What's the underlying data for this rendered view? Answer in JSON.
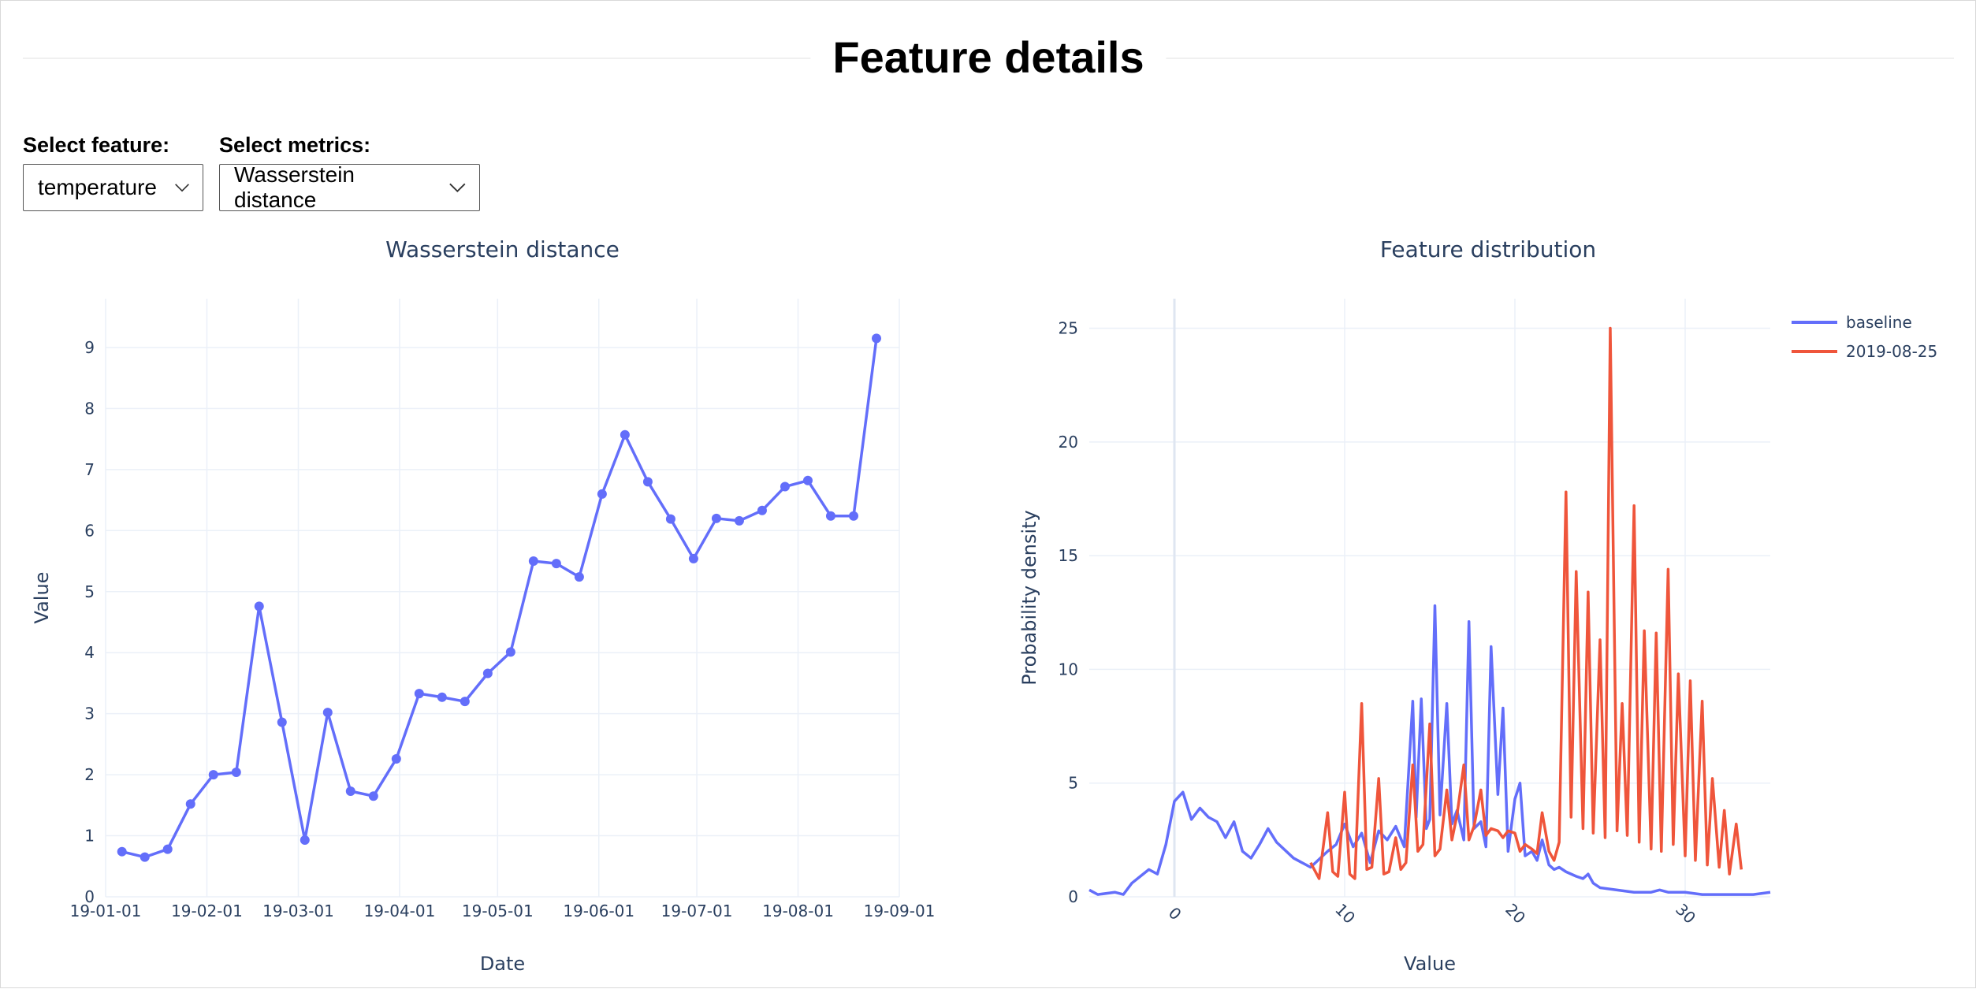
{
  "page": {
    "title": "Feature details"
  },
  "controls": {
    "feature_label": "Select feature:",
    "feature_value": "temperature",
    "metric_label": "Select metrics:",
    "metric_value": "Wasserstein distance"
  },
  "colors": {
    "primary": "#636efa",
    "secondary": "#ef553b",
    "text": "#2a3f5f",
    "grid": "#ebf0f8"
  },
  "chart_data": [
    {
      "type": "line",
      "title": "Wasserstein distance",
      "xlabel": "Date",
      "ylabel": "Value",
      "x_ticks": [
        "19-01-01",
        "19-02-01",
        "19-03-01",
        "19-04-01",
        "19-05-01",
        "19-06-01",
        "19-07-01",
        "19-08-01",
        "19-09-01"
      ],
      "y_ticks": [
        0,
        1,
        2,
        3,
        4,
        5,
        6,
        7,
        8,
        9
      ],
      "xlim": [
        "2019-01-01",
        "2019-09-01"
      ],
      "ylim": [
        0,
        9.8
      ],
      "grid": true,
      "series": [
        {
          "x": [
            "2019-01-06",
            "2019-01-13",
            "2019-01-20",
            "2019-01-27",
            "2019-02-03",
            "2019-02-10",
            "2019-02-17",
            "2019-02-24",
            "2019-03-03",
            "2019-03-10",
            "2019-03-17",
            "2019-03-24",
            "2019-03-31",
            "2019-04-07",
            "2019-04-14",
            "2019-04-21",
            "2019-04-28",
            "2019-05-05",
            "2019-05-12",
            "2019-05-19",
            "2019-05-26",
            "2019-06-02",
            "2019-06-09",
            "2019-06-16",
            "2019-06-23",
            "2019-06-30",
            "2019-07-07",
            "2019-07-14",
            "2019-07-21",
            "2019-07-28",
            "2019-08-04",
            "2019-08-11",
            "2019-08-18",
            "2019-08-25"
          ],
          "values": [
            0.74,
            0.65,
            0.78,
            1.52,
            2.0,
            2.04,
            4.76,
            2.86,
            0.93,
            3.02,
            1.73,
            1.65,
            2.26,
            3.33,
            3.27,
            3.2,
            3.66,
            4.01,
            5.5,
            5.46,
            5.24,
            6.6,
            7.57,
            6.8,
            6.19,
            5.54,
            6.2,
            6.16,
            6.33,
            6.72,
            6.82,
            6.24,
            6.24,
            9.15
          ]
        }
      ]
    },
    {
      "type": "line",
      "title": "Feature distribution",
      "xlabel": "Value",
      "ylabel": "Probability density",
      "x_ticks": [
        0,
        10,
        20,
        30
      ],
      "y_ticks": [
        0,
        5,
        10,
        15,
        20,
        25
      ],
      "xlim": [
        -5,
        35
      ],
      "ylim": [
        0,
        26.3
      ],
      "grid": true,
      "legend": "top-right",
      "series": [
        {
          "name": "baseline",
          "x": [
            -5,
            -4.5,
            -3.5,
            -3,
            -2.5,
            -2,
            -1.5,
            -1,
            -0.5,
            0,
            0.5,
            1,
            1.5,
            2,
            2.5,
            3,
            3.5,
            4,
            4.5,
            5,
            5.5,
            6,
            7,
            8,
            9,
            9.5,
            10,
            10.5,
            11,
            11.5,
            12,
            12.5,
            13,
            13.5,
            14,
            14.2,
            14.5,
            14.8,
            15,
            15.3,
            15.6,
            16,
            16.3,
            16.6,
            17,
            17.3,
            17.6,
            18,
            18.3,
            18.6,
            19,
            19.3,
            19.6,
            20,
            20.3,
            20.6,
            21,
            21.3,
            21.6,
            22,
            22.3,
            22.6,
            23,
            23.3,
            23.6,
            24,
            24.3,
            24.6,
            25,
            26,
            27,
            28,
            28.5,
            29,
            30,
            31,
            32,
            33,
            34,
            35
          ],
          "values": [
            0.3,
            0.1,
            0.2,
            0.1,
            0.6,
            0.9,
            1.2,
            1.0,
            2.3,
            4.2,
            4.6,
            3.4,
            3.9,
            3.5,
            3.3,
            2.6,
            3.3,
            2.0,
            1.7,
            2.3,
            3.0,
            2.4,
            1.7,
            1.3,
            2.0,
            2.3,
            3.2,
            2.2,
            2.8,
            1.5,
            2.9,
            2.5,
            3.1,
            2.2,
            8.6,
            3.5,
            8.7,
            3.0,
            3.4,
            12.8,
            3.6,
            8.5,
            3.2,
            3.8,
            2.5,
            12.1,
            3.0,
            3.3,
            2.2,
            11.0,
            4.5,
            8.3,
            2.0,
            4.3,
            5.0,
            1.8,
            2.0,
            1.6,
            2.5,
            1.4,
            1.2,
            1.3,
            1.1,
            1.0,
            0.9,
            0.8,
            1.0,
            0.6,
            0.4,
            0.3,
            0.2,
            0.2,
            0.3,
            0.2,
            0.2,
            0.1,
            0.1,
            0.1,
            0.1,
            0.2
          ]
        },
        {
          "name": "2019-08-25",
          "x": [
            8,
            8.5,
            9,
            9.3,
            9.6,
            10,
            10.3,
            10.6,
            11,
            11.3,
            11.6,
            12,
            12.3,
            12.6,
            13,
            13.3,
            13.6,
            14,
            14.3,
            14.6,
            15,
            15.3,
            15.6,
            16,
            16.3,
            16.6,
            17,
            17.3,
            17.6,
            18,
            18.3,
            18.6,
            19,
            19.3,
            19.6,
            20,
            20.3,
            20.6,
            21,
            21.3,
            21.6,
            22,
            22.3,
            22.6,
            23,
            23.3,
            23.6,
            24,
            24.3,
            24.6,
            25,
            25.3,
            25.6,
            26,
            26.3,
            26.6,
            27,
            27.3,
            27.6,
            28,
            28.3,
            28.6,
            29,
            29.3,
            29.6,
            30,
            30.3,
            30.6,
            31,
            31.3,
            31.6,
            32,
            32.3,
            32.6,
            33,
            33.3
          ],
          "values": [
            1.5,
            0.8,
            3.7,
            1.1,
            0.9,
            4.6,
            1.0,
            0.8,
            8.5,
            1.2,
            1.3,
            5.2,
            1.0,
            1.1,
            2.6,
            1.2,
            1.5,
            5.8,
            2.0,
            2.3,
            7.6,
            1.8,
            2.1,
            4.7,
            2.5,
            3.6,
            5.8,
            2.5,
            3.1,
            4.7,
            2.7,
            3.0,
            2.9,
            2.6,
            2.9,
            2.8,
            2.0,
            2.3,
            2.1,
            1.9,
            3.7,
            2.0,
            1.6,
            2.4,
            17.8,
            3.5,
            14.3,
            3.0,
            13.4,
            2.8,
            11.3,
            2.6,
            25.0,
            2.9,
            8.5,
            2.7,
            17.2,
            2.4,
            11.7,
            2.1,
            11.6,
            2.0,
            14.4,
            2.3,
            9.8,
            1.8,
            9.5,
            1.6,
            8.6,
            1.4,
            5.2,
            1.3,
            3.8,
            1.0,
            3.2,
            1.2
          ]
        }
      ]
    }
  ]
}
